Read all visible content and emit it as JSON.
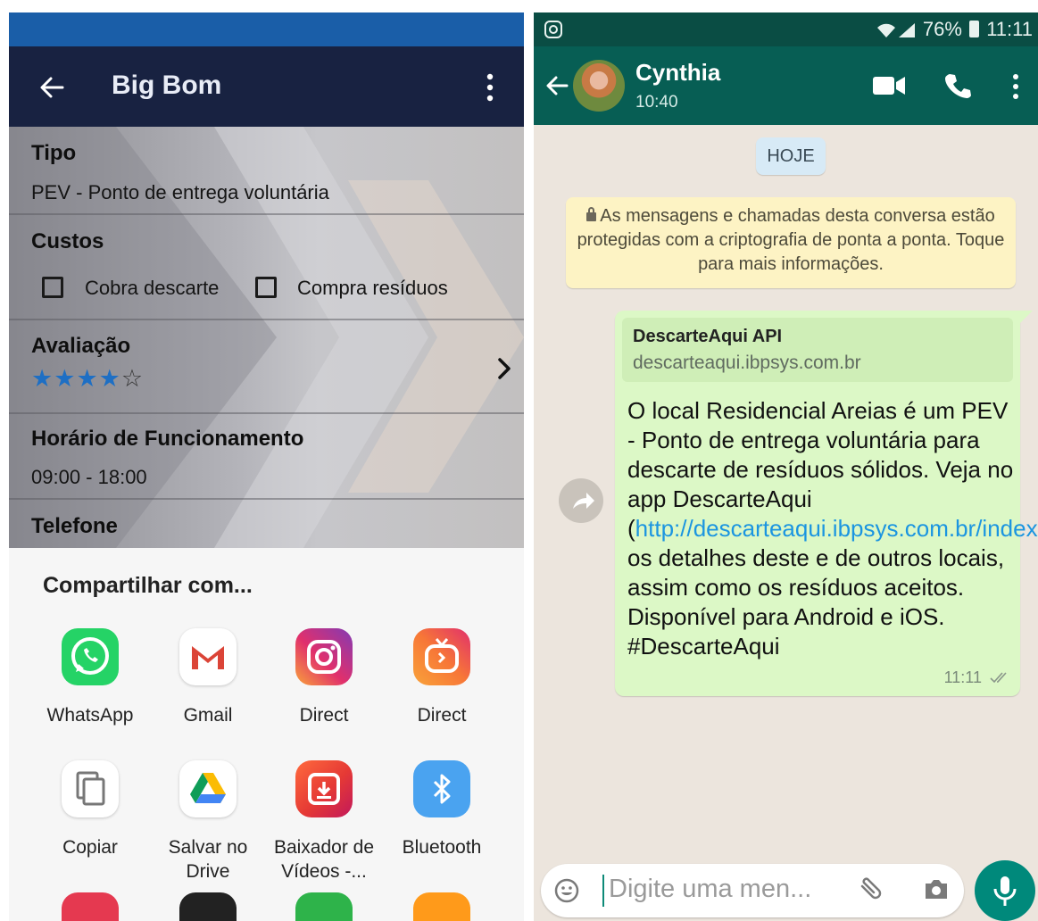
{
  "left": {
    "app_title": "Big Bom",
    "sections": {
      "tipo_heading": "Tipo",
      "tipo_value": "PEV - Ponto de entrega voluntária",
      "custos_heading": "Custos",
      "cobra_label": "Cobra descarte",
      "compra_label": "Compra resíduos",
      "cobra_checked": false,
      "compra_checked": false,
      "avaliacao_heading": "Avaliação",
      "rating": 4,
      "rating_max": 5,
      "horario_heading": "Horário de Funcionamento",
      "horario_value": "09:00 - 18:00",
      "telefone_heading": "Telefone"
    },
    "share_sheet": {
      "title": "Compartilhar com...",
      "apps": [
        {
          "label": "WhatsApp",
          "icon": "whatsapp-icon",
          "color": "#25d366"
        },
        {
          "label": "Gmail",
          "icon": "gmail-icon",
          "color": "#ffffff"
        },
        {
          "label": "Direct",
          "icon": "instagram-icon",
          "color": "#c13584"
        },
        {
          "label": "Direct",
          "icon": "igtv-icon",
          "color": "#f77737"
        },
        {
          "label": "Copiar",
          "icon": "copy-icon",
          "color": "#ffffff"
        },
        {
          "label": "Salvar no Drive",
          "icon": "drive-icon",
          "color": "#ffffff"
        },
        {
          "label": "Baixador de Vídeos -...",
          "icon": "video-downloader-icon",
          "color": "#e53935"
        },
        {
          "label": "Bluetooth",
          "icon": "bluetooth-icon",
          "color": "#4aa3f0"
        }
      ]
    }
  },
  "right": {
    "status": {
      "battery": "76%",
      "time": "11:11"
    },
    "contact": {
      "name": "Cynthia",
      "last_seen": "10:40"
    },
    "date_pill": "HOJE",
    "encryption_notice": "As mensagens e chamadas desta conversa estão protegidas com a criptografia de ponta a ponta. Toque para mais informações.",
    "message": {
      "preview_title": "DescarteAqui API",
      "preview_url": "descarteaqui.ibpsys.com.br",
      "text_before_link": "O local Residencial Areias é um PEV - Ponto de entrega voluntária para descarte de resíduos sólidos. Veja no app DescarteAqui (",
      "link": "http://descarteaqui.ibpsys.com.br/index.html",
      "text_after_link": ") os detalhes deste e de outros locais, assim como os resíduos aceitos. Disponível para Android e iOS. #DescarteAqui",
      "time": "11:11"
    },
    "composer": {
      "placeholder": "Digite uma men..."
    }
  }
}
